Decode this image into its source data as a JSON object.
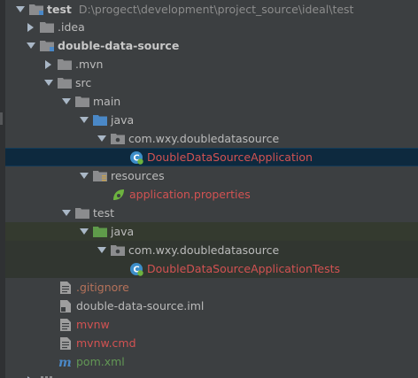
{
  "project_tree": {
    "root": {
      "name": "test",
      "path": "D:\\progect\\development\\project_source\\ideal\\test"
    },
    "idea": ".idea",
    "module": "double-data-source",
    "mvn": ".mvn",
    "src": "src",
    "main": "main",
    "main_java": "java",
    "main_package": "com.wxy.doubledatasource",
    "main_class": "DoubleDataSourceApplication",
    "resources": "resources",
    "app_properties": "application.properties",
    "test": "test",
    "test_java": "java",
    "test_package": "com.wxy.doubledatasource",
    "test_class": "DoubleDataSourceApplicationTests",
    "gitignore": ".gitignore",
    "iml": "double-data-source.iml",
    "mvnw": "mvnw",
    "mvnw_cmd": "mvnw.cmd",
    "pom": "pom.xml"
  },
  "colors": {
    "background": "#3c3f41",
    "selection": "#0d293e",
    "vcs_unversioned": "#d25252",
    "vcs_added": "#629755",
    "text": "#bbbbbb",
    "path_text": "#8c8c8c"
  },
  "icons": {
    "expanded": "chevron-down-icon",
    "collapsed": "chevron-right-icon",
    "folder": "folder-icon",
    "source_folder": "source-folder-icon",
    "test_folder": "test-folder-icon",
    "package": "package-icon",
    "spring_class": "spring-class-icon",
    "spring_properties": "spring-leaf-icon",
    "text_file": "text-file-icon",
    "maven": "maven-icon"
  }
}
